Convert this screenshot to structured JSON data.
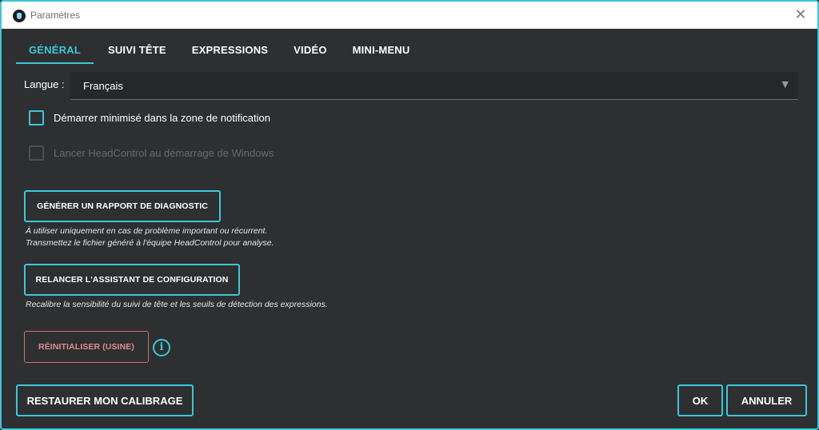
{
  "window": {
    "title": "Paramètres",
    "close_glyph": "✕"
  },
  "tabs": [
    {
      "label": "GÉNÉRAL",
      "active": true
    },
    {
      "label": "SUIVI TÊTE",
      "active": false
    },
    {
      "label": "EXPRESSIONS",
      "active": false
    },
    {
      "label": "VIDÉO",
      "active": false
    },
    {
      "label": "MINI-MENU",
      "active": false
    }
  ],
  "language": {
    "label": "Langue :",
    "value": "Français",
    "chevron_glyph": "▼"
  },
  "options": {
    "start_minimized": {
      "label": "Démarrer minimisé dans la zone de notification",
      "checked": false,
      "enabled": true
    },
    "launch_at_startup": {
      "label": "Lancer HeadControl au démarrage de Windows",
      "checked": false,
      "enabled": false
    }
  },
  "diagnostic": {
    "button_label": "GÉNÉRER UN RAPPORT DE DIAGNOSTIC",
    "hint_line1": "À utiliser uniquement en cas de problème important ou récurrent.",
    "hint_line2": "Transmettez le fichier généré à l'équipe HeadControl pour analyse."
  },
  "assistant": {
    "button_label": "RELANCER L'ASSISTANT DE CONFIGURATION",
    "hint": "Recalibre la sensibilité du suivi de tête et les seuils de détection des expressions."
  },
  "reset": {
    "button_label": "RÉINITIALISER (USINE)",
    "info_glyph": "i"
  },
  "footer": {
    "restore_label": "RESTAURER MON CALIBRAGE",
    "ok_label": "OK",
    "cancel_label": "ANNULER"
  },
  "colors": {
    "accent": "#3ec6d8",
    "background": "#2d2f31",
    "danger": "#e28b8b"
  }
}
